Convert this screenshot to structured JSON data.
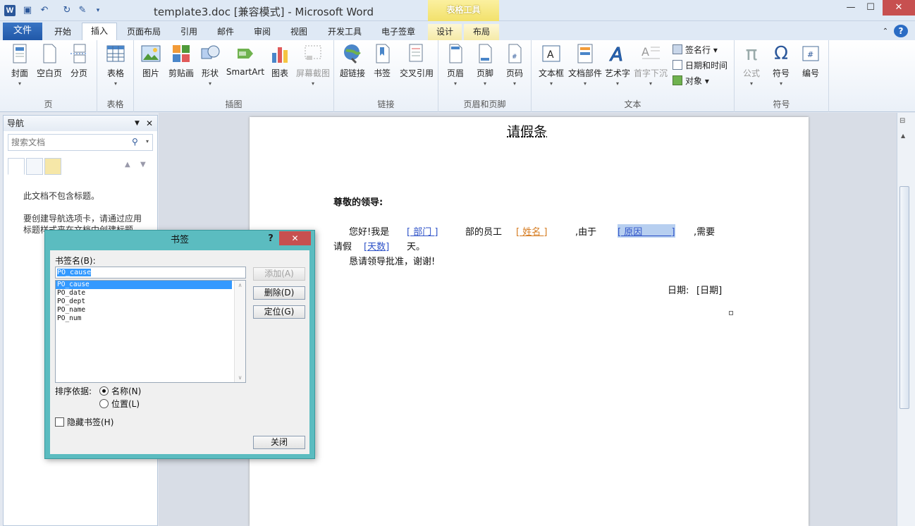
{
  "window": {
    "title": "template3.doc [兼容模式] - Microsoft Word",
    "context_tab_group": "表格工具",
    "minimize": "—",
    "maximize": "☐",
    "close": "✕"
  },
  "tabs": {
    "file": "文件",
    "items": [
      "开始",
      "插入",
      "页面布局",
      "引用",
      "邮件",
      "审阅",
      "视图",
      "开发工具",
      "电子签章",
      "设计",
      "布局"
    ],
    "active": "插入"
  },
  "ribbon": {
    "groups": {
      "pages": {
        "label": "页",
        "buttons": [
          "封面",
          "空白页",
          "分页"
        ]
      },
      "tables": {
        "label": "表格",
        "buttons": [
          "表格"
        ]
      },
      "illustrations": {
        "label": "插图",
        "buttons": [
          "图片",
          "剪贴画",
          "形状",
          "SmartArt",
          "图表",
          "屏幕截图"
        ]
      },
      "links": {
        "label": "链接",
        "buttons": [
          "超链接",
          "书签",
          "交叉引用"
        ]
      },
      "header_footer": {
        "label": "页眉和页脚",
        "buttons": [
          "页眉",
          "页脚",
          "页码"
        ]
      },
      "text": {
        "label": "文本",
        "buttons": [
          "文本框",
          "文档部件",
          "艺术字",
          "首字下沉"
        ],
        "small": [
          "签名行",
          "日期和时间",
          "对象"
        ]
      },
      "symbols": {
        "label": "符号",
        "buttons": [
          "公式",
          "符号",
          "编号"
        ]
      }
    }
  },
  "nav": {
    "title": "导航",
    "search_placeholder": "搜索文档",
    "message1": "此文档不包含标题。",
    "message2": "要创建导航选项卡，请通过应用标题样式来在文档中创建标题。"
  },
  "document": {
    "title": "请假条",
    "greeting": "尊敬的领导:",
    "p1_a": "您好!我是",
    "bm_dept": "[ 部门 ]",
    "p1_b": "部的员工",
    "bm_name": "[ 姓名 ]",
    "p1_c": ",由于",
    "bm_cause": "[ 原因          ]",
    "p1_d": ",需要",
    "p2_a": "请假",
    "bm_num": "[天数]",
    "p2_b": "天。",
    "p3": "恳请领导批准，谢谢!",
    "date_label": "日期:",
    "bm_date": "[日期]"
  },
  "dialog": {
    "title": "书签",
    "help": "?",
    "close": "✕",
    "name_label": "书签名(B):",
    "name_value": "PO_cause",
    "list": [
      "PO_cause",
      "PO_date",
      "PO_dept",
      "PO_name",
      "PO_num"
    ],
    "selected": "PO_cause",
    "add": "添加(A)",
    "delete": "删除(D)",
    "goto": "定位(G)",
    "sort_label": "排序依据:",
    "sort_name": "名称(N)",
    "sort_location": "位置(L)",
    "hidden": "隐藏书签(H)",
    "close_button": "关闭"
  }
}
